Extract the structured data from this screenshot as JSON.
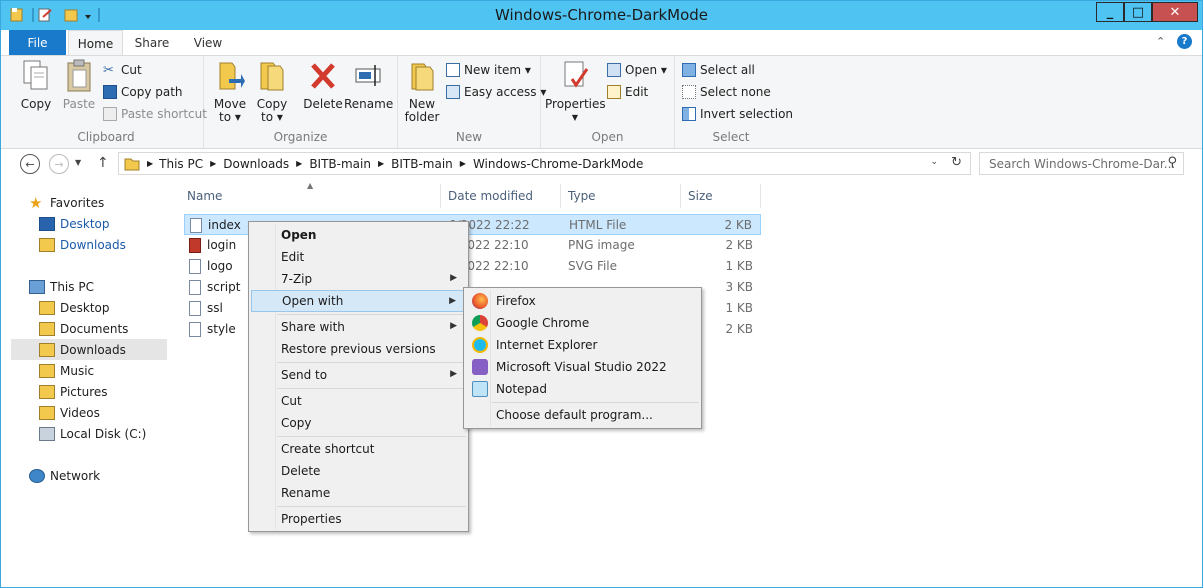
{
  "window": {
    "title": "Windows-Chrome-DarkMode",
    "minimize": "_",
    "maximize": "□",
    "close": "✕"
  },
  "tabs": {
    "file": "File",
    "home": "Home",
    "share": "Share",
    "view": "View"
  },
  "ribbon": {
    "clipboard": {
      "label": "Clipboard",
      "copy": "Copy",
      "paste": "Paste",
      "cut": "Cut",
      "copy_path": "Copy path",
      "paste_shortcut": "Paste shortcut"
    },
    "organize": {
      "label": "Organize",
      "move_to_1": "Move",
      "move_to_2": "to ▾",
      "copy_to_1": "Copy",
      "copy_to_2": "to ▾",
      "delete": "Delete",
      "rename": "Rename"
    },
    "new": {
      "label": "New",
      "new_folder_1": "New",
      "new_folder_2": "folder",
      "new_item": "New item ▾",
      "easy_access": "Easy access ▾"
    },
    "open": {
      "label": "Open",
      "properties": "Properties",
      "open": "Open ▾",
      "edit": "Edit"
    },
    "select": {
      "label": "Select",
      "select_all": "Select all",
      "select_none": "Select none",
      "invert": "Invert selection"
    }
  },
  "address": {
    "crumbs": [
      "This PC",
      "Downloads",
      "BITB-main",
      "BITB-main",
      "Windows-Chrome-DarkMode"
    ],
    "search_placeholder": "Search Windows-Chrome-Dar..."
  },
  "nav": {
    "favorites": "Favorites",
    "fav_desktop": "Desktop",
    "fav_downloads": "Downloads",
    "this_pc": "This PC",
    "desktop": "Desktop",
    "documents": "Documents",
    "downloads": "Downloads",
    "music": "Music",
    "pictures": "Pictures",
    "videos": "Videos",
    "local_disk": "Local Disk (C:)",
    "network": "Network"
  },
  "columns": {
    "name": "Name",
    "date": "Date modified",
    "type": "Type",
    "size": "Size"
  },
  "files": [
    {
      "name": "index",
      "date": "0/2022 22:22",
      "type": "HTML File",
      "size": "2 KB"
    },
    {
      "name": "login",
      "date": "0/2022 22:10",
      "type": "PNG image",
      "size": "2 KB"
    },
    {
      "name": "logo",
      "date": "0/2022 22:10",
      "type": "SVG File",
      "size": "1 KB"
    },
    {
      "name": "script",
      "date": "",
      "type": "",
      "size": "3 KB"
    },
    {
      "name": "ssl",
      "date": "",
      "type": "",
      "size": "1 KB"
    },
    {
      "name": "style",
      "date": "",
      "type": "",
      "size": "2 KB"
    }
  ],
  "context_menu": {
    "open": "Open",
    "edit": "Edit",
    "zip": "7-Zip",
    "open_with": "Open with",
    "share_with": "Share with",
    "restore": "Restore previous versions",
    "send_to": "Send to",
    "cut": "Cut",
    "copy": "Copy",
    "create_shortcut": "Create shortcut",
    "delete": "Delete",
    "rename": "Rename",
    "properties": "Properties"
  },
  "open_with_menu": {
    "firefox": "Firefox",
    "chrome": "Google Chrome",
    "ie": "Internet Explorer",
    "vs": "Microsoft Visual Studio 2022",
    "notepad": "Notepad",
    "choose": "Choose default program..."
  },
  "colors": {
    "titlebar": "#4fc4f2",
    "file_tab": "#1979ca",
    "selection": "#cce8ff"
  }
}
